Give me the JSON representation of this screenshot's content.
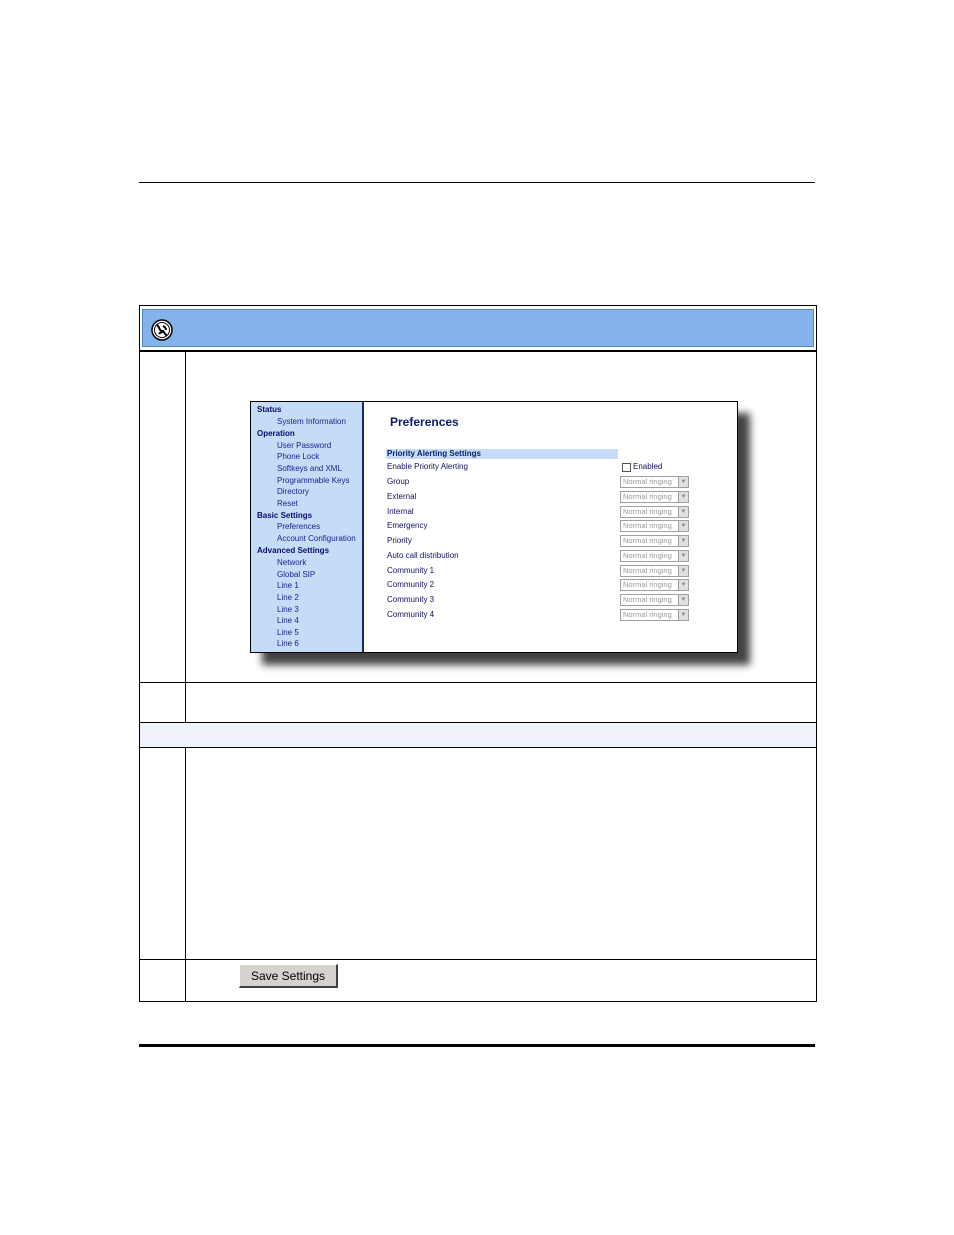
{
  "nav": {
    "items": [
      {
        "label": "Status",
        "type": "section"
      },
      {
        "label": "System Information",
        "type": "sub"
      },
      {
        "label": "Operation",
        "type": "section"
      },
      {
        "label": "User Password",
        "type": "sub"
      },
      {
        "label": "Phone Lock",
        "type": "sub"
      },
      {
        "label": "Softkeys and XML",
        "type": "sub"
      },
      {
        "label": "Programmable Keys",
        "type": "sub"
      },
      {
        "label": "Directory",
        "type": "sub"
      },
      {
        "label": "Reset",
        "type": "sub"
      },
      {
        "label": "Basic Settings",
        "type": "section"
      },
      {
        "label": "Preferences",
        "type": "sub"
      },
      {
        "label": "Account Configuration",
        "type": "sub"
      },
      {
        "label": "Advanced Settings",
        "type": "section"
      },
      {
        "label": "Network",
        "type": "sub"
      },
      {
        "label": "Global SIP",
        "type": "sub"
      },
      {
        "label": "Line 1",
        "type": "sub"
      },
      {
        "label": "Line 2",
        "type": "sub"
      },
      {
        "label": "Line 3",
        "type": "sub"
      },
      {
        "label": "Line 4",
        "type": "sub"
      },
      {
        "label": "Line 5",
        "type": "sub"
      },
      {
        "label": "Line 6",
        "type": "sub"
      }
    ]
  },
  "pane": {
    "title": "Preferences",
    "section_title": "Priority Alerting Settings",
    "enable": {
      "label": "Enable Priority Alerting",
      "checkbox_label": "Enabled"
    },
    "fields": [
      {
        "label": "Group",
        "value": "Normal ringing"
      },
      {
        "label": "External",
        "value": "Normal ringing"
      },
      {
        "label": "Internal",
        "value": "Normal ringing"
      },
      {
        "label": "Emergency",
        "value": "Normal ringing"
      },
      {
        "label": "Priority",
        "value": "Normal ringing"
      },
      {
        "label": "Auto call distribution",
        "value": "Normal ringing"
      },
      {
        "label": "Community 1",
        "value": "Normal ringing"
      },
      {
        "label": "Community 2",
        "value": "Normal ringing"
      },
      {
        "label": "Community 3",
        "value": "Normal ringing"
      },
      {
        "label": "Community 4",
        "value": "Normal ringing"
      }
    ]
  },
  "buttons": {
    "save": "Save Settings"
  },
  "colors": {
    "header": "#84b2ea",
    "nav": "#c4dcf5"
  }
}
